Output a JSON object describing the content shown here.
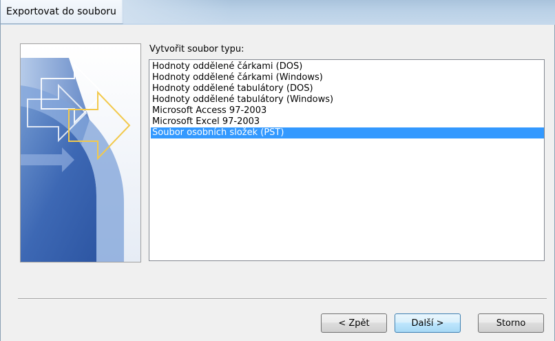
{
  "window": {
    "title": "Exportovat do souboru"
  },
  "file_types": {
    "label": "Vytvořit soubor typu:",
    "items": [
      "Hodnoty oddělené čárkami (DOS)",
      "Hodnoty oddělené čárkami (Windows)",
      "Hodnoty oddělené tabulátory (DOS)",
      "Hodnoty oddělené tabulátory (Windows)",
      "Microsoft Access 97-2003",
      "Microsoft Excel 97-2003",
      "Soubor osobních složek (PST)"
    ],
    "selected_index": 6
  },
  "buttons": {
    "back": "< Zpět",
    "next": "Další >",
    "cancel": "Storno"
  },
  "colors": {
    "selection": "#3399ff",
    "arrow_accent": "#f2c94c"
  }
}
